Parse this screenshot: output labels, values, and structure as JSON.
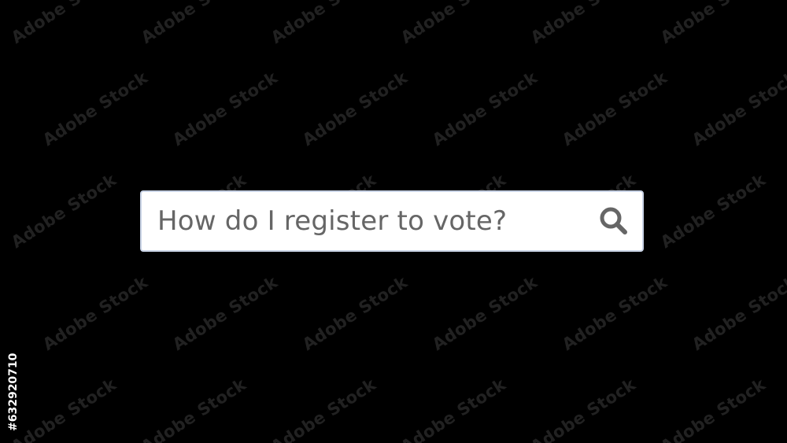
{
  "search": {
    "query": "How do I register to vote?",
    "icon": "search-icon"
  },
  "watermark": {
    "text": "Adobe Stock"
  },
  "side_label": {
    "text": "#632920710"
  },
  "colors": {
    "background": "#000000",
    "box_background": "#ffffff",
    "box_border": "#c9d3e6",
    "query_text": "#666666",
    "icon": "#666666"
  }
}
